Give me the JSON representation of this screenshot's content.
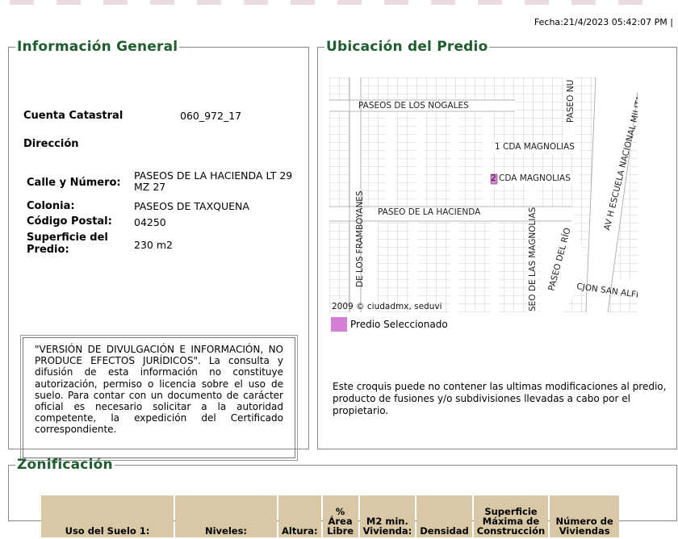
{
  "fecha": "Fecha:21/4/2023 05:42:07 PM |",
  "general": {
    "title": "Información General",
    "cuenta_label": "Cuenta Catastral",
    "cuenta_value": "060_972_17",
    "direccion_label": "Dirección",
    "calle_label": "Calle y Número:",
    "calle_value": "PASEOS DE LA HACIENDA LT 29 MZ 27",
    "colonia_label": "Colonia:",
    "colonia_value": "PASEOS DE TAXQUENA",
    "cp_label": "Código Postal:",
    "cp_value": "04250",
    "superficie_label": "Superficie del Predio:",
    "superficie_value": "230 m2",
    "disclaimer": "\"VERSIÓN DE DIVULGACIÓN E INFORMACIÓN, NO PRODUCE EFECTOS JURÍDICOS\". La consulta y difusión de esta información no constituye autorización, permiso o licencia sobre el uso de suelo. Para contar con un documento de carácter oficial es necesario solicitar a la autoridad competente, la expedición del Certificado correspondiente."
  },
  "ubicacion": {
    "title": "Ubicación del Predio",
    "map_streets": {
      "nogales": "PASEOS DE LOS NOGALES",
      "paseo_nu": "PASEO NU",
      "magnolias1": "1 CDA MAGNOLIAS",
      "magnolias2": "2 CDA MAGNOLIAS",
      "hacienda": "PASEO DE LA HACIENDA",
      "framboyanes": "DE LOS FRAMBOYANES",
      "las_magnolias": "SEO DE LAS MAGNOLIAS",
      "del_rio": "PASEO DEL RÍO",
      "san_alfre": "CJON SAN ALFRE",
      "militar": "AV H ESCUELA NACIONAL MILITAR"
    },
    "map_credit": "2009 © ciudadmx, seduvi",
    "legend_label": "Predio Seleccionado",
    "selected_color": "#d47fd3",
    "croquis_note": "Este croquis puede no contener las ultimas modificaciones al predio, producto de fusiones y/o subdivisiones llevadas a cabo por el propietario."
  },
  "zonificacion": {
    "title": "Zonificación",
    "headers": [
      "Uso del Suelo 1:",
      "Niveles:",
      "Altura:",
      "% Área Libre",
      "M2 min. Vivienda:",
      "Densidad",
      "Superficie Máxima de Construcción",
      "Número de Viviendas"
    ]
  }
}
